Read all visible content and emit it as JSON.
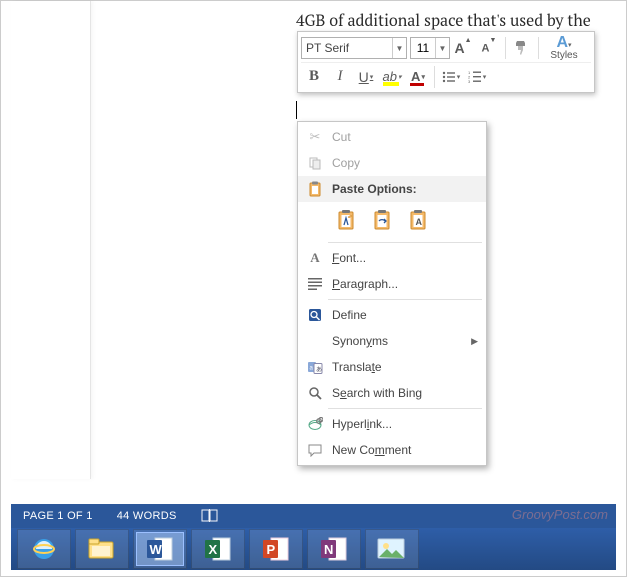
{
  "document": {
    "visible_text": "4GB of additional space that's used by the"
  },
  "mini_toolbar": {
    "font_name": "PT Serif",
    "font_size": "11",
    "grow_font_tip": "A",
    "shrink_font_tip": "A",
    "styles_label": "Styles",
    "bold": "B",
    "italic": "I",
    "underline": "U"
  },
  "context_menu": {
    "cut": "Cut",
    "copy": "Copy",
    "paste_options": "Paste Options:",
    "font": "Font...",
    "paragraph": "Paragraph...",
    "define": "Define",
    "synonyms": "Synonyms",
    "translate": "Translate",
    "search_bing": "Search with Bing",
    "hyperlink": "Hyperlink...",
    "new_comment": "New Comment"
  },
  "status_bar": {
    "page": "PAGE 1 OF 1",
    "words": "44 WORDS"
  },
  "watermark": "GroovyPost.com"
}
